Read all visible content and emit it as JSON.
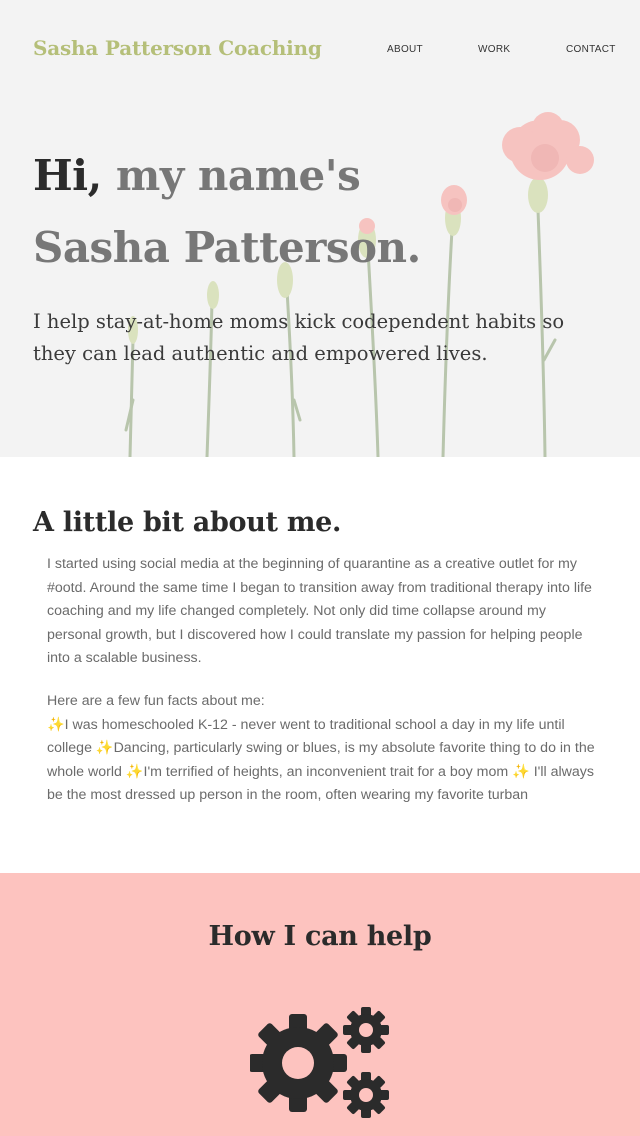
{
  "header": {
    "brand": "Sasha Patterson Coaching",
    "nav": [
      {
        "label": "ABOUT"
      },
      {
        "label": "WORK"
      },
      {
        "label": "CONTACT"
      }
    ]
  },
  "hero": {
    "greeting": "Hi,",
    "title_rest": " my name's",
    "title_line2": "Sasha Patterson.",
    "subtitle": "I help stay-at-home moms kick codependent habits so they can lead authentic and empowered lives.",
    "background_icon": "carnation-flowers-photo"
  },
  "about": {
    "title": "A little bit about me.",
    "paragraph1": "I started using social media at the beginning of quarantine as a creative outlet for my #ootd. Around the same time I began to transition away from traditional therapy into life coaching and my life changed completely. Not only did time collapse around my personal growth, but I discovered how I could translate my passion for helping people into a scalable business.",
    "facts_intro": "Here are a few fun facts about me:",
    "facts": "✨I was homeschooled K-12 - never went to traditional school a day in my life until college ✨Dancing, particularly swing or blues, is my absolute favorite thing to do in the whole world ✨I'm terrified of heights, an inconvenient trait for a boy mom ✨ I'll always be the most dressed up person in the room, often wearing my favorite turban"
  },
  "help": {
    "title": "How I can help",
    "icon": "gears-icon"
  },
  "colors": {
    "brand": "#b5bf79",
    "help_background": "#fdc3bf",
    "heading": "#2b2b2b",
    "body_text": "#6b6b6b"
  }
}
